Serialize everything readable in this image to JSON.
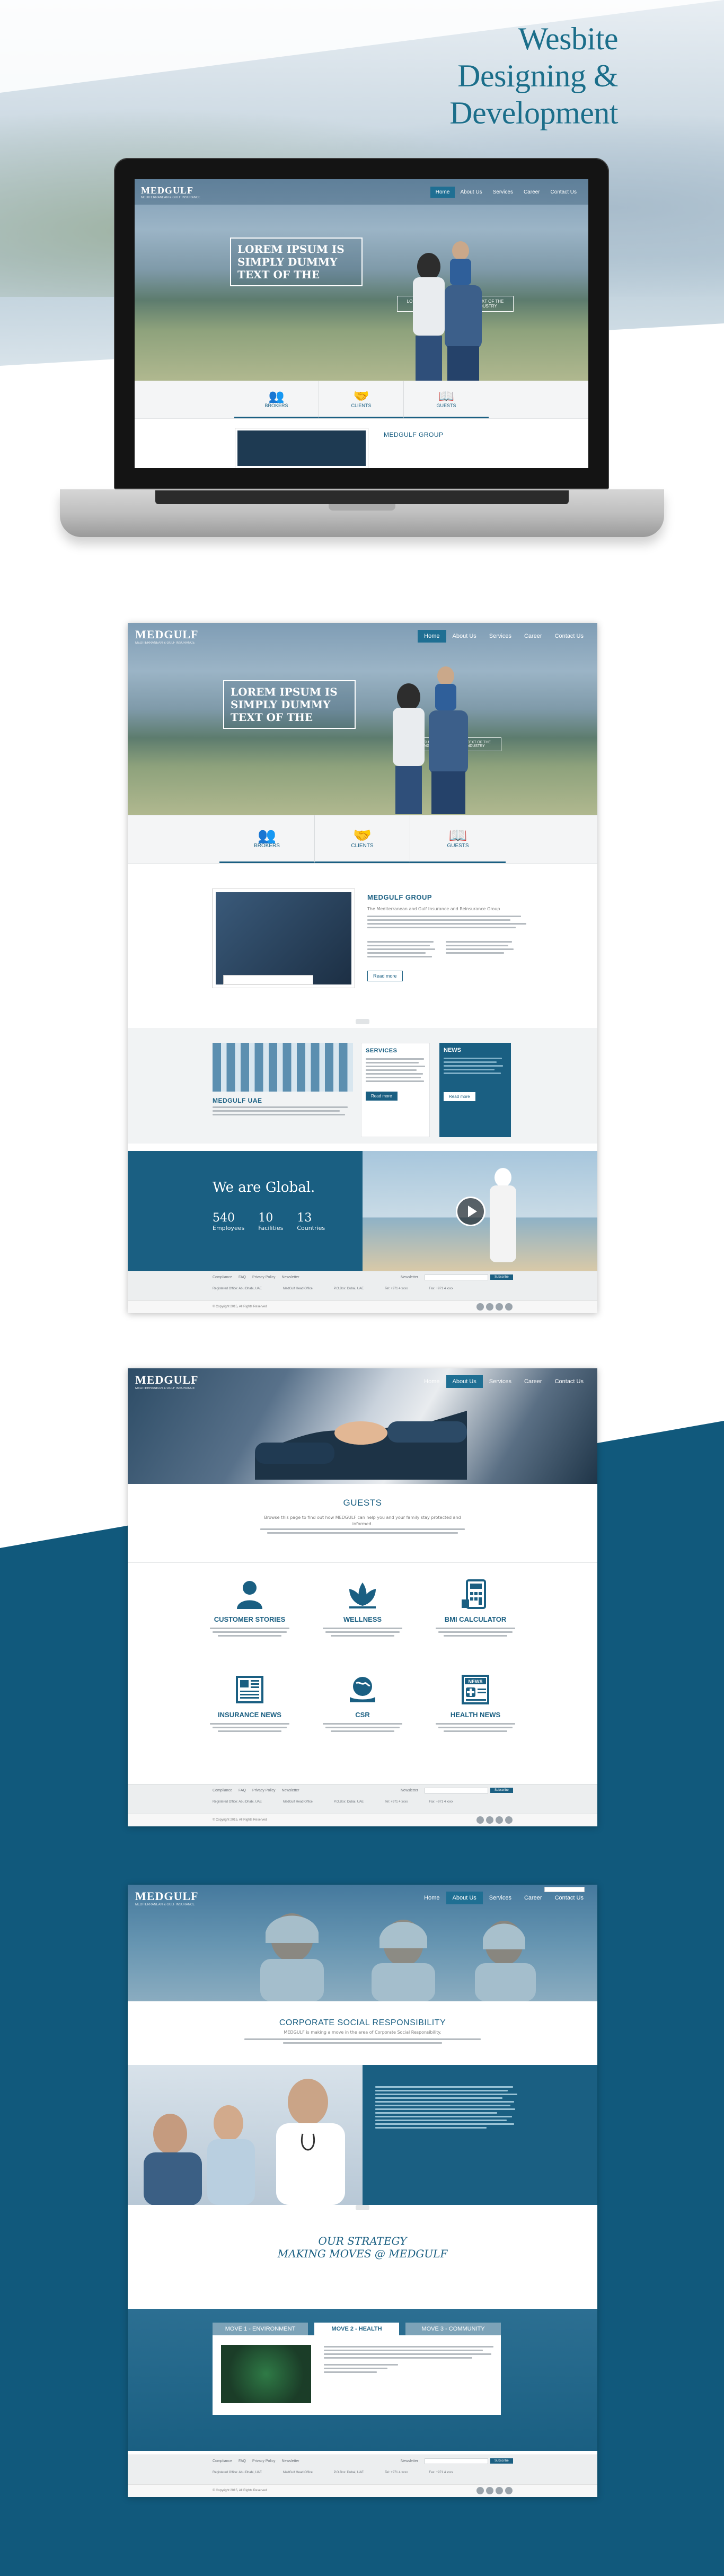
{
  "headline": [
    "Wesbite",
    "Designing &",
    "Development"
  ],
  "site": {
    "logo": "MEDGULF",
    "logo_sub": "MEDITERRANEAN & GULF INSURANCE",
    "nav": [
      "Home",
      "About Us",
      "Services",
      "Career",
      "Contact Us"
    ],
    "lorem_title": [
      "LOREM IPSUM IS",
      "SIMPLY DUMMY",
      "TEXT OF THE"
    ],
    "lorem_sub": "LOREM IPSUM IS SIMPLY DUMMY TEXT OF THE PRINTING AND TYPESETTING INDUSTRY",
    "tabs": [
      "BROKERS",
      "CLIENTS",
      "GUESTS"
    ],
    "group_title": "MEDGULF GROUP",
    "group_body": "The Mediterranean and Gulf Insurance and Reinsurance Group",
    "read_more": "Read more",
    "uae_title": "MEDGULF UAE",
    "services_title": "SERVICES",
    "news_title": "NEWS",
    "global_title": "We are Global.",
    "stats": [
      {
        "value": "540",
        "label": "Employees"
      },
      {
        "value": "10",
        "label": "Facilities"
      },
      {
        "value": "13",
        "label": "Countries"
      }
    ],
    "footer_links": [
      "Compliance",
      "FAQ",
      "Privacy Policy",
      "Newsletter"
    ],
    "newsletter_label": "Newsletter",
    "subscribe": "Subscribe",
    "addresses": [
      "Registered Office: Abu Dhabi, UAE",
      "MedGulf Head Office",
      "P.O.Box: Dubai, UAE",
      "Tel: +971 4 xxxx",
      "Fax: +971 4 xxxx"
    ],
    "copyright": "© Copyright 2015, All Rights Reserved"
  },
  "guests": {
    "title": "GUESTS",
    "intro": "Browse this page to find out how MEDGULF can help you and your family stay protected and informed.",
    "features": [
      {
        "label": "CUSTOMER STORIES",
        "icon": "person-icon"
      },
      {
        "label": "WELLNESS",
        "icon": "lotus-icon"
      },
      {
        "label": "BMI CALCULATOR",
        "icon": "calculator-icon"
      },
      {
        "label": "INSURANCE NEWS",
        "icon": "newspaper-icon"
      },
      {
        "label": "CSR",
        "icon": "globe-hands-icon"
      },
      {
        "label": "HEALTH NEWS",
        "icon": "health-news-icon"
      }
    ]
  },
  "csr": {
    "title": "CORPORATE SOCIAL RESPONSIBILITY",
    "intro": "MEDGULF is making a move in the area of Corporate Social Responsibility.",
    "strategy_line1": "OUR STRATEGY",
    "strategy_line2": "MAKING MOVES @ MEDGULF",
    "strategy_tabs": [
      "MOVE 1 - ENVIRONMENT",
      "MOVE 2 - HEALTH",
      "MOVE 3 - COMMUNITY"
    ],
    "active_tab": "MOVE 2 - HEALTH"
  },
  "colors": {
    "brand": "#1a5f82",
    "teal_bg": "#11597c",
    "headline": "#1b6e8a"
  }
}
